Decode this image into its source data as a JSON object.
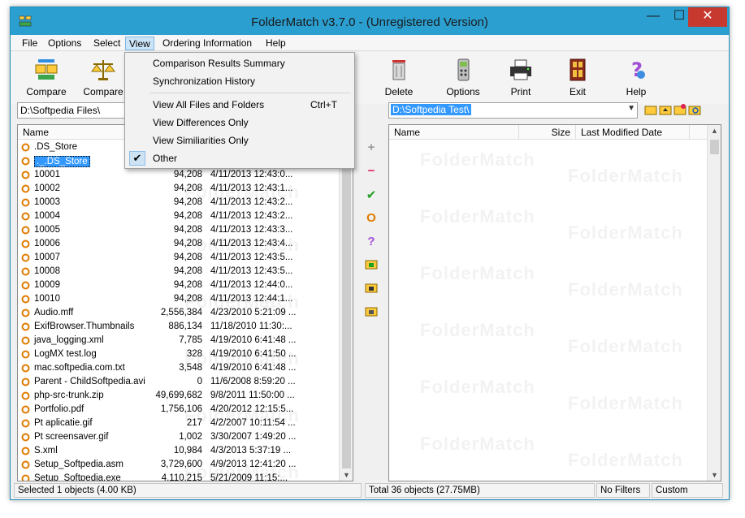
{
  "window": {
    "title": "FolderMatch v3.7.0 - (Unregistered Version)",
    "minimize": "—",
    "maximize": "☐",
    "close": "✕"
  },
  "menu": {
    "items": [
      {
        "label": "File"
      },
      {
        "label": "Options"
      },
      {
        "label": "Select"
      },
      {
        "label": "View"
      },
      {
        "label": "Ordering Information"
      },
      {
        "label": "Help"
      }
    ],
    "view_dropdown": [
      {
        "label": "Comparison Results Summary",
        "shortcut": ""
      },
      {
        "label": "Synchronization History",
        "shortcut": ""
      },
      {
        "label": "View All Files and Folders",
        "shortcut": "Ctrl+T"
      },
      {
        "label": "View Differences Only",
        "shortcut": ""
      },
      {
        "label": "View Similiarities Only",
        "shortcut": ""
      },
      {
        "label": "Other",
        "shortcut": "",
        "checked": true
      }
    ],
    "check_glyph": "✔"
  },
  "toolbar": [
    {
      "label": "Compare",
      "icon": "compare-folders-icon"
    },
    {
      "label": "Compare",
      "icon": "compare-scales-icon"
    },
    {
      "label": "Delete",
      "icon": "trash-icon"
    },
    {
      "label": "Options",
      "icon": "options-icon"
    },
    {
      "label": "Print",
      "icon": "printer-icon"
    },
    {
      "label": "Exit",
      "icon": "exit-door-icon"
    },
    {
      "label": "Help",
      "icon": "help-icon"
    }
  ],
  "left_pane": {
    "path": "D:\\Softpedia Files\\",
    "columns": {
      "name": "Name"
    },
    "watermark": "FolderMatch",
    "files": [
      {
        "name": ".DS_Store",
        "size": "",
        "date": ""
      },
      {
        "name": "._.DS_Store",
        "size": "",
        "date": "",
        "selected": true
      },
      {
        "name": "10001",
        "size": "94,208",
        "date": "4/11/2013 12:43:0..."
      },
      {
        "name": "10002",
        "size": "94,208",
        "date": "4/11/2013 12:43:1..."
      },
      {
        "name": "10003",
        "size": "94,208",
        "date": "4/11/2013 12:43:2..."
      },
      {
        "name": "10004",
        "size": "94,208",
        "date": "4/11/2013 12:43:2..."
      },
      {
        "name": "10005",
        "size": "94,208",
        "date": "4/11/2013 12:43:3..."
      },
      {
        "name": "10006",
        "size": "94,208",
        "date": "4/11/2013 12:43:4..."
      },
      {
        "name": "10007",
        "size": "94,208",
        "date": "4/11/2013 12:43:5..."
      },
      {
        "name": "10008",
        "size": "94,208",
        "date": "4/11/2013 12:43:5..."
      },
      {
        "name": "10009",
        "size": "94,208",
        "date": "4/11/2013 12:44:0..."
      },
      {
        "name": "10010",
        "size": "94,208",
        "date": "4/11/2013 12:44:1..."
      },
      {
        "name": "Audio.mff",
        "size": "2,556,384",
        "date": "4/23/2010 5:21:09 ..."
      },
      {
        "name": "ExifBrowser.Thumbnails",
        "size": "886,134",
        "date": "11/18/2010 11:30:..."
      },
      {
        "name": "java_logging.xml",
        "size": "7,785",
        "date": "4/19/2010 6:41:48 ..."
      },
      {
        "name": "LogMX test.log",
        "size": "328",
        "date": "4/19/2010 6:41:50 ..."
      },
      {
        "name": "mac.softpedia.com.txt",
        "size": "3,548",
        "date": "4/19/2010 6:41:48 ..."
      },
      {
        "name": "Parent - ChildSoftpedia.avi",
        "size": "0",
        "date": "11/6/2008 8:59:20 ..."
      },
      {
        "name": "php-src-trunk.zip",
        "size": "49,699,682",
        "date": "9/8/2011 11:50:00 ..."
      },
      {
        "name": "Portfolio.pdf",
        "size": "1,756,106",
        "date": "4/20/2012 12:15:5..."
      },
      {
        "name": "Pt aplicatie.gif",
        "size": "217",
        "date": "4/2/2007 10:11:54 ..."
      },
      {
        "name": "Pt screensaver.gif",
        "size": "1,002",
        "date": "3/30/2007 1:49:20 ..."
      },
      {
        "name": "S.xml",
        "size": "10,984",
        "date": "4/3/2013 5:37:19 ..."
      },
      {
        "name": "Setup_Softpedia.asm",
        "size": "3,729,600",
        "date": "4/9/2013 12:41:20 ..."
      },
      {
        "name": "Setup_Softpedia.exe",
        "size": "4,110,215",
        "date": "5/21/2009 11:15:..."
      }
    ]
  },
  "right_pane": {
    "path": "D:\\Softpedia Test\\",
    "columns": {
      "name": "Name",
      "size": "Size",
      "date": "Last Modified Date"
    },
    "watermark": "FolderMatch"
  },
  "mid_tools": [
    {
      "glyph": "+",
      "icon": "plus-icon",
      "color": "#999999"
    },
    {
      "glyph": "−",
      "icon": "minus-icon",
      "color": "#e0245e"
    },
    {
      "glyph": "✔",
      "icon": "check-icon",
      "color": "#1fa01f"
    },
    {
      "glyph": "O",
      "icon": "circle-o-icon",
      "color": "#e07b00"
    },
    {
      "glyph": "?",
      "icon": "question-icon",
      "color": "#a24fd8"
    },
    {
      "glyph": "",
      "icon": "folder-check-icon"
    },
    {
      "glyph": "",
      "icon": "folder-x-icon"
    },
    {
      "glyph": "",
      "icon": "folder-camera-icon"
    }
  ],
  "status": {
    "left": "Selected 1 objects  (4.00 KB)",
    "right": "Total 36 objects  (27.75MB)",
    "filters": "No Filters",
    "mode": "Custom"
  },
  "colors": {
    "titlebar": "#2b9fd0",
    "close": "#c7392e",
    "selection": "#3399ff",
    "file_icon": "#e07b00"
  }
}
